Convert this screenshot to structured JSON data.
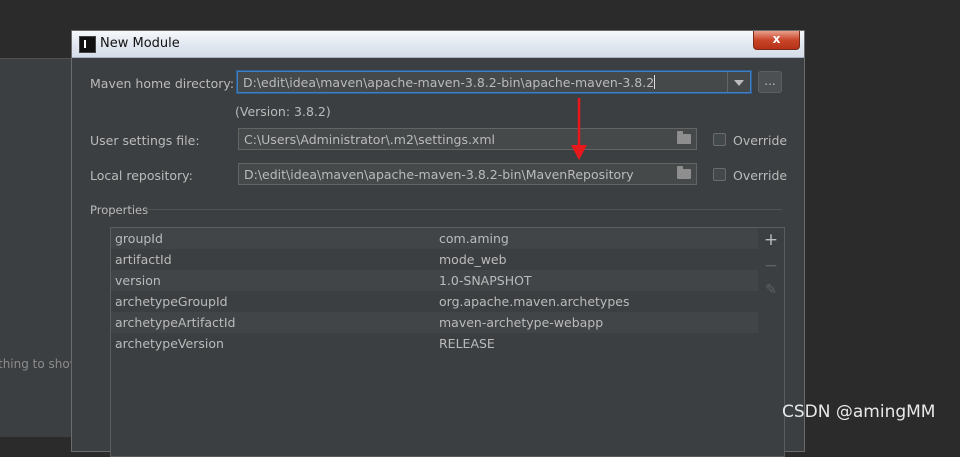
{
  "background": {
    "empty_text": "thing to show"
  },
  "dialog": {
    "title": "New Module",
    "close_label": "x",
    "maven_home_label": "Maven home directory:",
    "maven_home_value": "D:\\edit\\idea\\maven\\apache-maven-3.8.2-bin\\apache-maven-3.8.2",
    "version_text": "(Version: 3.8.2)",
    "browse_label": "...",
    "user_settings_label": "User settings file:",
    "user_settings_value": "C:\\Users\\Administrator\\.m2\\settings.xml",
    "local_repo_label": "Local repository:",
    "local_repo_value": "D:\\edit\\idea\\maven\\apache-maven-3.8.2-bin\\MavenRepository",
    "override_label": "Override",
    "properties_label": "Properties",
    "properties": [
      {
        "key": "groupId",
        "value": "com.aming"
      },
      {
        "key": "artifactId",
        "value": "mode_web"
      },
      {
        "key": "version",
        "value": "1.0-SNAPSHOT"
      },
      {
        "key": "archetypeGroupId",
        "value": "org.apache.maven.archetypes"
      },
      {
        "key": "archetypeArtifactId",
        "value": "maven-archetype-webapp"
      },
      {
        "key": "archetypeVersion",
        "value": "RELEASE"
      }
    ],
    "toolbar": {
      "add": "+",
      "remove": "−",
      "edit": "✎"
    }
  },
  "annotation_color": "#e8191c",
  "watermark": "CSDN @amingMM"
}
